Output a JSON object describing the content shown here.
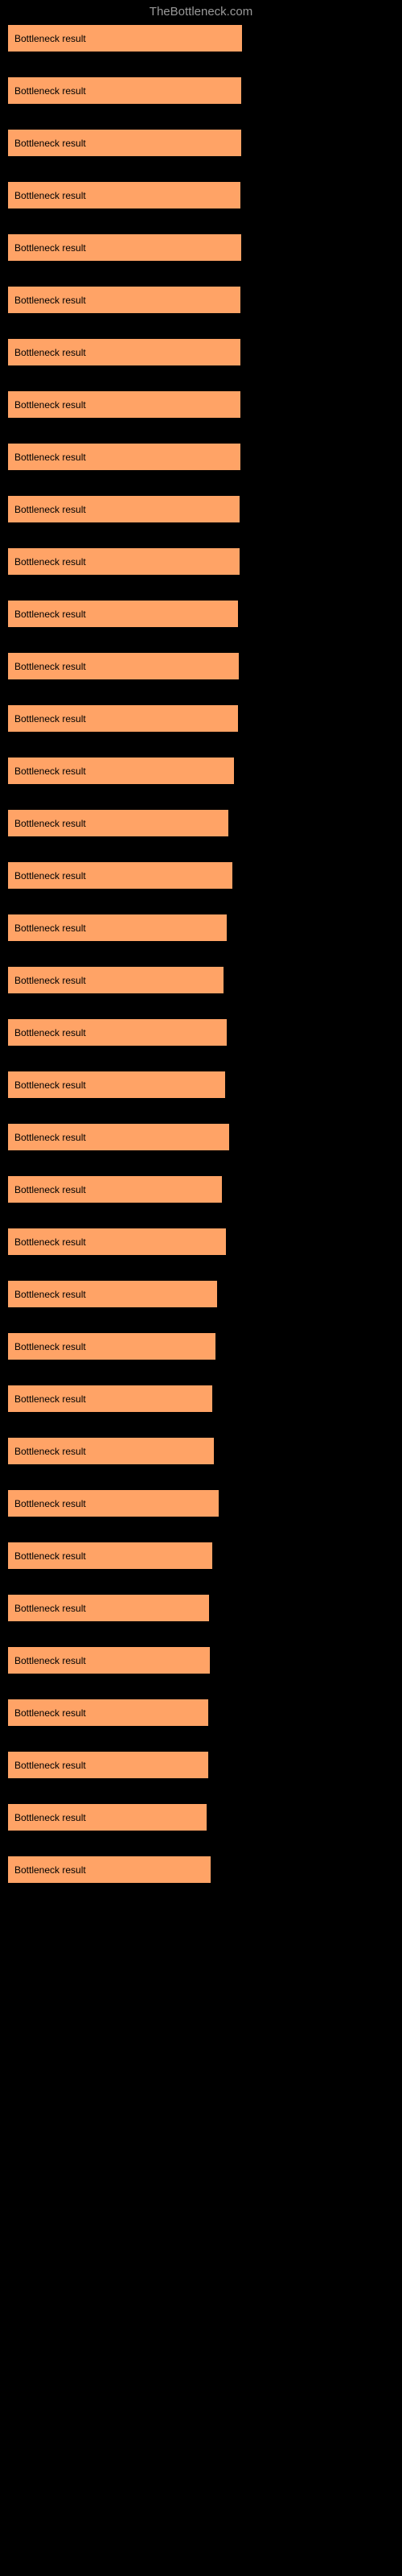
{
  "header": {
    "site": "TheBottleneck.com"
  },
  "chart_data": {
    "type": "bar",
    "title": "",
    "xlabel": "",
    "ylabel": "",
    "xlim": [
      0,
      100
    ],
    "bar_label": "Bottleneck result",
    "bar_color": "#FFA366",
    "series": [
      {
        "label": "Bottleneck result",
        "value": 83.8
      },
      {
        "label": "Bottleneck result",
        "value": 83.7
      },
      {
        "label": "Bottleneck result",
        "value": 83.5
      },
      {
        "label": "Bottleneck result",
        "value": 83.4
      },
      {
        "label": "Bottleneck result",
        "value": 83.5
      },
      {
        "label": "Bottleneck result",
        "value": 83.2
      },
      {
        "label": "Bottleneck result",
        "value": 83.4
      },
      {
        "label": "Bottleneck result",
        "value": 83.4
      },
      {
        "label": "Bottleneck result",
        "value": 83.2
      },
      {
        "label": "Bottleneck result",
        "value": 83.1
      },
      {
        "label": "Bottleneck result",
        "value": 82.9
      },
      {
        "label": "Bottleneck result",
        "value": 82.5
      },
      {
        "label": "Bottleneck result",
        "value": 82.6
      },
      {
        "label": "Bottleneck result",
        "value": 82.4
      },
      {
        "label": "Bottleneck result",
        "value": 80.9
      },
      {
        "label": "Bottleneck result",
        "value": 79.0
      },
      {
        "label": "Bottleneck result",
        "value": 80.3
      },
      {
        "label": "Bottleneck result",
        "value": 78.4
      },
      {
        "label": "Bottleneck result",
        "value": 77.1
      },
      {
        "label": "Bottleneck result",
        "value": 78.5
      },
      {
        "label": "Bottleneck result",
        "value": 77.9
      },
      {
        "label": "Bottleneck result",
        "value": 79.3
      },
      {
        "label": "Bottleneck result",
        "value": 76.7
      },
      {
        "label": "Bottleneck result",
        "value": 78.2
      },
      {
        "label": "Bottleneck result",
        "value": 74.9
      },
      {
        "label": "Bottleneck result",
        "value": 74.3
      },
      {
        "label": "Bottleneck result",
        "value": 73.1
      },
      {
        "label": "Bottleneck result",
        "value": 73.9
      },
      {
        "label": "Bottleneck result",
        "value": 75.4
      },
      {
        "label": "Bottleneck result",
        "value": 73.2
      },
      {
        "label": "Bottleneck result",
        "value": 72.1
      },
      {
        "label": "Bottleneck result",
        "value": 72.4
      },
      {
        "label": "Bottleneck result",
        "value": 71.9
      },
      {
        "label": "Bottleneck result",
        "value": 71.7
      },
      {
        "label": "Bottleneck result",
        "value": 71.3
      },
      {
        "label": "Bottleneck result",
        "value": 72.6
      }
    ]
  }
}
